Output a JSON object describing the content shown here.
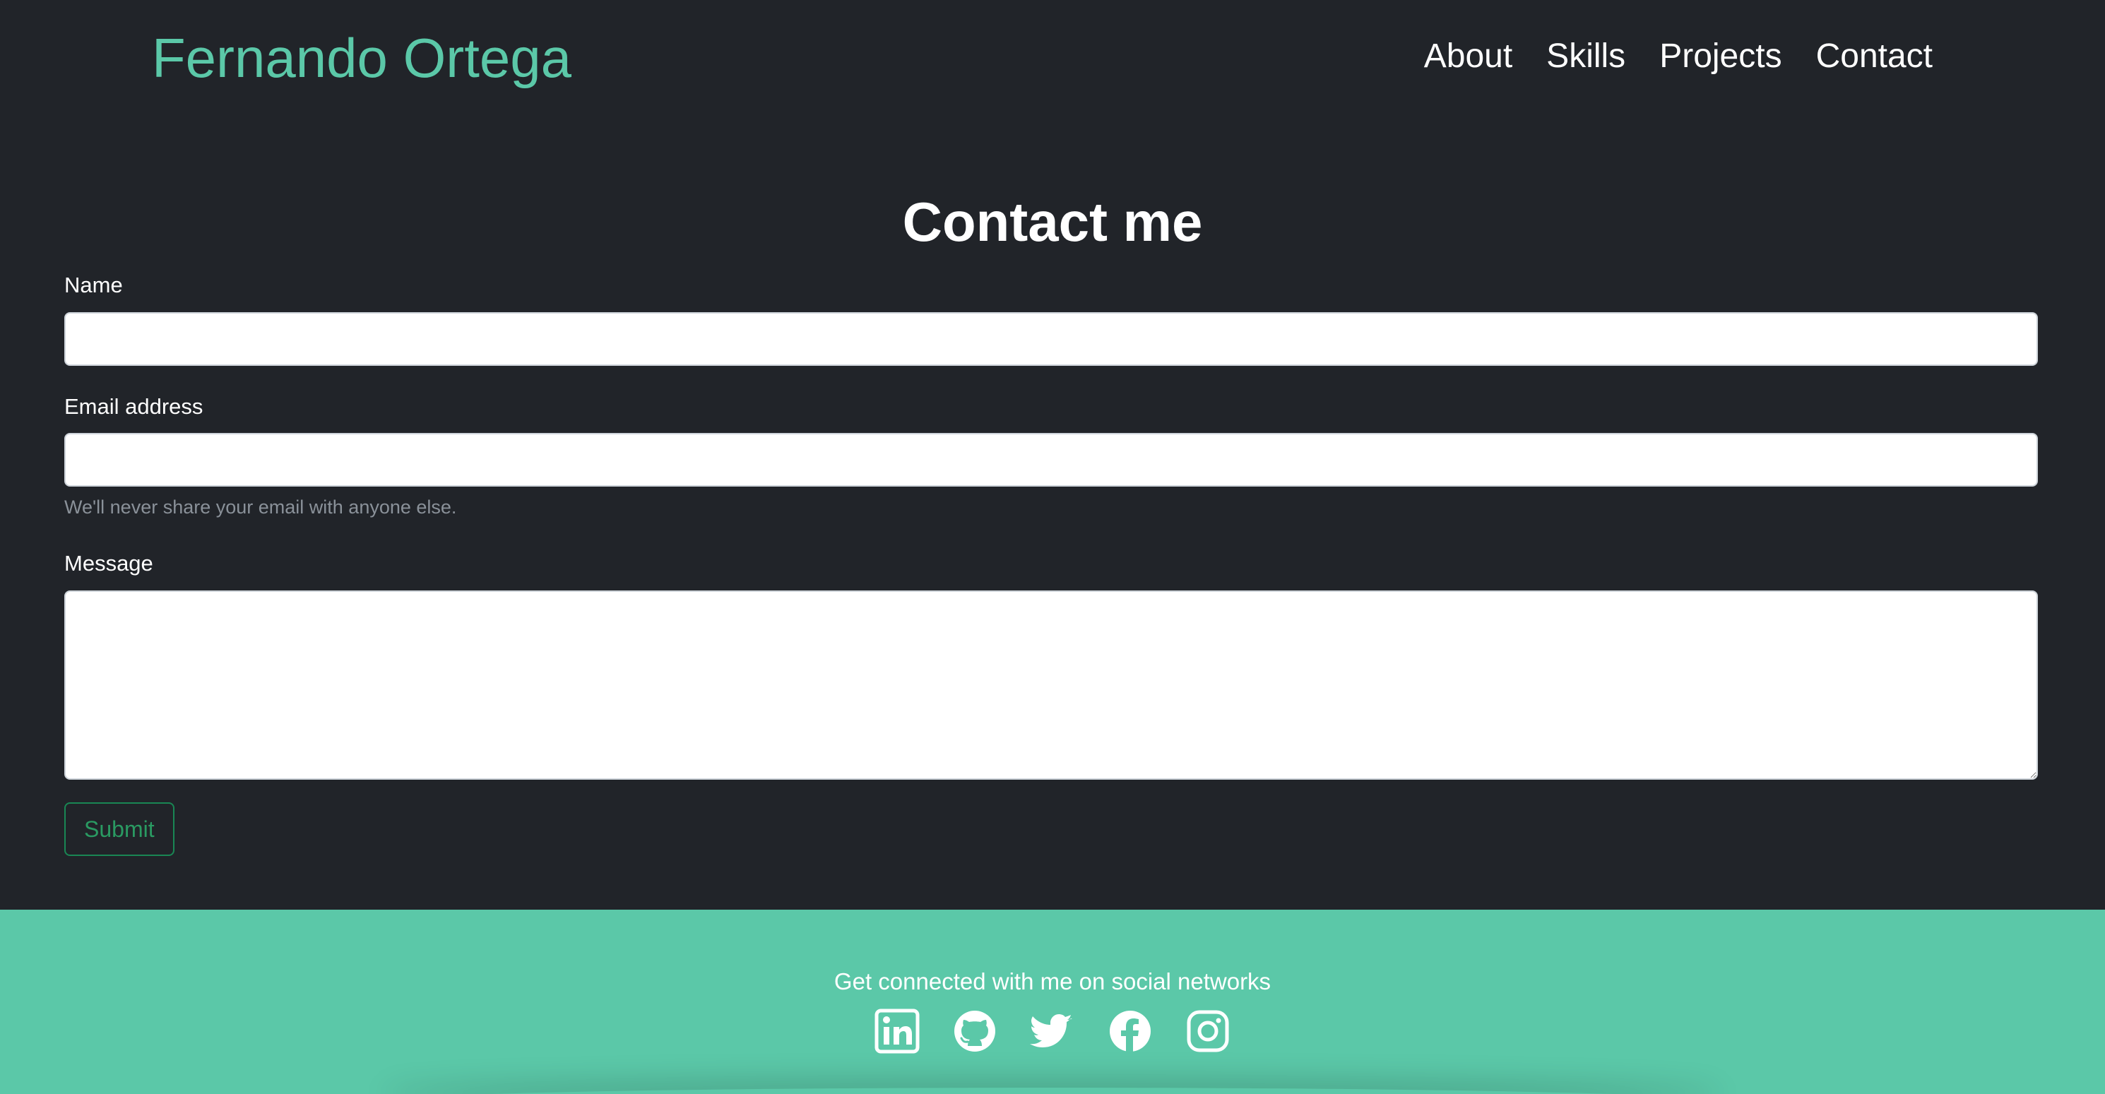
{
  "navbar": {
    "brand": "Fernando Ortega",
    "links": [
      {
        "label": "About"
      },
      {
        "label": "Skills"
      },
      {
        "label": "Projects"
      },
      {
        "label": "Contact"
      }
    ]
  },
  "contact": {
    "title": "Contact me",
    "name_label": "Name",
    "name_value": "",
    "email_label": "Email address",
    "email_value": "",
    "email_help": "We'll never share your email with anyone else.",
    "message_label": "Message",
    "message_value": "",
    "submit_label": "Submit"
  },
  "footer": {
    "text": "Get connected with me on social networks",
    "social_icons": [
      "linkedin-icon",
      "github-icon",
      "twitter-icon",
      "facebook-icon",
      "instagram-icon"
    ]
  },
  "colors": {
    "background": "#212429",
    "accent": "#5bc8a8",
    "submit_outline": "#198754"
  }
}
